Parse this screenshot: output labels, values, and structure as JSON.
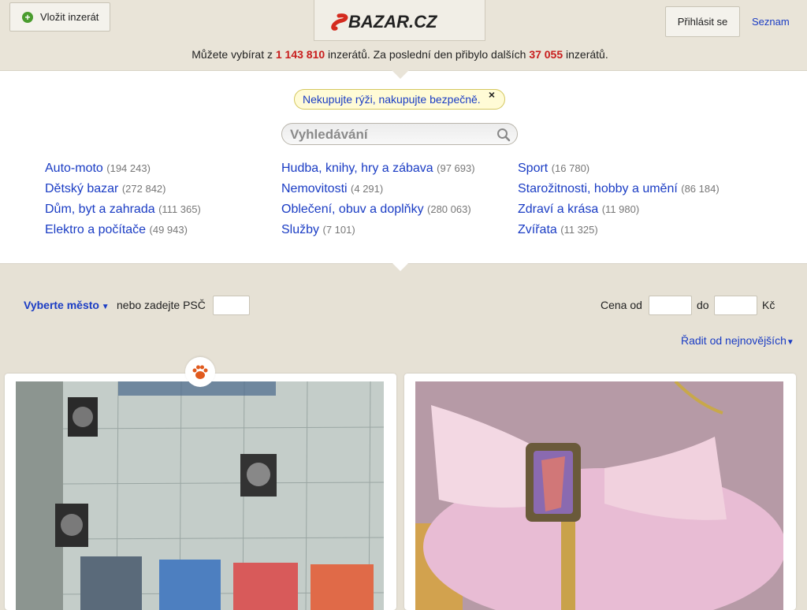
{
  "header": {
    "add_listing_label": "Vložit inzerát",
    "logo_text": "SBAZAR.CZ",
    "login_label": "Přihlásit se",
    "seznam_label": "Seznam",
    "stats_prefix": "Můžete vybírat z ",
    "stats_total": "1 143 810",
    "stats_middle": " inzerátů. Za poslední den přibylo dalších ",
    "stats_new": "37 055",
    "stats_suffix": " inzerátů."
  },
  "notice": {
    "text": "Nekupujte rýži, nakupujte bezpečně.",
    "close": "×"
  },
  "search": {
    "placeholder": "Vyhledávání"
  },
  "categories": [
    {
      "label": "Auto-moto",
      "count": "(194 243)"
    },
    {
      "label": "Dětský bazar",
      "count": "(272 842)"
    },
    {
      "label": "Dům, byt a zahrada",
      "count": "(111 365)"
    },
    {
      "label": "Elektro a počítače",
      "count": "(49 943)"
    },
    {
      "label": "Hudba, knihy, hry a zábava",
      "count": "(97 693)"
    },
    {
      "label": "Nemovitosti",
      "count": "(4 291)"
    },
    {
      "label": "Oblečení, obuv a doplňky",
      "count": "(280 063)"
    },
    {
      "label": "Služby",
      "count": "(7 101)"
    },
    {
      "label": "Sport",
      "count": "(16 780)"
    },
    {
      "label": "Starožitnosti, hobby a umění",
      "count": "(86 184)"
    },
    {
      "label": "Zdraví a krása",
      "count": "(11 980)"
    },
    {
      "label": "Zvířata",
      "count": "(11 325)"
    }
  ],
  "filters": {
    "city_label": "Vyberte město",
    "psc_label": "nebo zadejte PSČ",
    "price_from": "Cena od",
    "price_to": "do",
    "currency": "Kč",
    "sort_label": "Řadit od nejnovějších"
  },
  "colors": {
    "link": "#1a3cc4",
    "count_red": "#c81d1d",
    "background": "#e6e1d5",
    "logo_red": "#d42a1e"
  },
  "icons": [
    "plus-icon",
    "search-icon",
    "close-icon",
    "paw-icon",
    "dropdown-arrow-icon"
  ]
}
